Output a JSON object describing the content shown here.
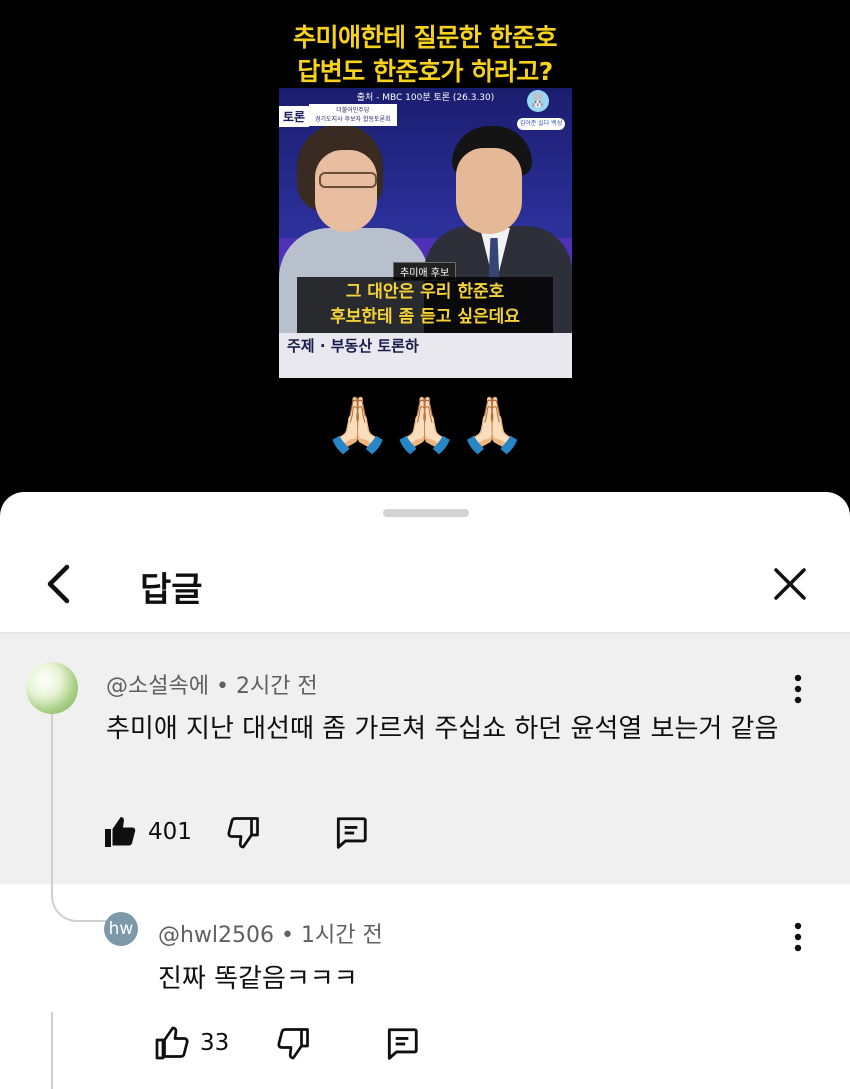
{
  "video": {
    "title_line1": "추미애한테 질문한 한준호",
    "title_line2": "답변도 한준호가 하라고?",
    "source": "출처 - MBC 100분 토론 (26.3.30)",
    "logo": "토론",
    "info_line1": "더불어민주당",
    "info_line2": "경기도지사 후보자 합동토론회",
    "channel_tag": "김어준 싫다 백성",
    "name_tag": "추미애 후보",
    "subtitle_line1": "그 대안은 우리 한준호",
    "subtitle_line2": "후보한테 좀 듣고 싶은데요",
    "lower_caption": "주제 · 부동산 토론하",
    "emoji_row": "🙏🏻🙏🏻🙏🏻"
  },
  "sheet": {
    "title": "답글"
  },
  "comment": {
    "author": "@소설속에",
    "time": "2시간 전",
    "text": "추미애 지난 대선때 좀 가르쳐 주십쇼 하던 윤석열 보는거 같음",
    "likes": "401"
  },
  "reply": {
    "avatar_text": "hw",
    "author": "@hwl2506",
    "time": "1시간 전",
    "text": "진짜 똑같음ㅋㅋㅋ",
    "likes": "33"
  },
  "icons": {
    "back": "chevron-left-icon",
    "close": "close-icon",
    "more": "more-vertical-icon",
    "like": "thumbs-up-icon",
    "dislike": "thumbs-down-icon",
    "reply": "comment-icon"
  }
}
